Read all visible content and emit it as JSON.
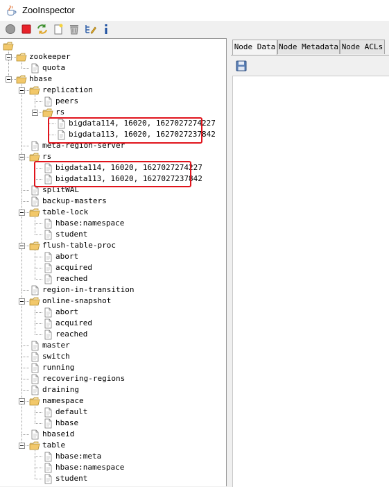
{
  "window": {
    "title": "ZooInspector"
  },
  "toolbar": {
    "buttons": [
      {
        "name": "connect-button",
        "icon": "grey-circle-icon"
      },
      {
        "name": "disconnect-button",
        "icon": "red-stop-icon"
      },
      {
        "name": "refresh-button",
        "icon": "refresh-arrows-icon"
      },
      {
        "name": "add-node-button",
        "icon": "new-document-icon"
      },
      {
        "name": "delete-node-button",
        "icon": "trash-icon"
      },
      {
        "name": "node-viewers-button",
        "icon": "tree-edit-icon"
      },
      {
        "name": "about-button",
        "icon": "info-icon"
      }
    ]
  },
  "tree": {
    "nodes": [
      {
        "label": "",
        "depth": 0,
        "type": "folder"
      },
      {
        "label": "zookeeper",
        "depth": 1,
        "type": "folder"
      },
      {
        "label": "quota",
        "depth": 2,
        "type": "file"
      },
      {
        "label": "hbase",
        "depth": 1,
        "type": "folder"
      },
      {
        "label": "replication",
        "depth": 2,
        "type": "folder"
      },
      {
        "label": "peers",
        "depth": 3,
        "type": "file"
      },
      {
        "label": "rs",
        "depth": 3,
        "type": "folder"
      },
      {
        "label": "bigdata114, 16020, 1627027274227",
        "depth": 4,
        "type": "file"
      },
      {
        "label": "bigdata113, 16020, 1627027237842",
        "depth": 4,
        "type": "file"
      },
      {
        "label": "meta-region-server",
        "depth": 2,
        "type": "file"
      },
      {
        "label": "rs",
        "depth": 2,
        "type": "folder"
      },
      {
        "label": "bigdata114, 16020, 1627027274227",
        "depth": 3,
        "type": "file"
      },
      {
        "label": "bigdata113, 16020, 1627027237842",
        "depth": 3,
        "type": "file"
      },
      {
        "label": "splitWAL",
        "depth": 2,
        "type": "file"
      },
      {
        "label": "backup-masters",
        "depth": 2,
        "type": "file"
      },
      {
        "label": "table-lock",
        "depth": 2,
        "type": "folder"
      },
      {
        "label": "hbase:namespace",
        "depth": 3,
        "type": "file"
      },
      {
        "label": "student",
        "depth": 3,
        "type": "file"
      },
      {
        "label": "flush-table-proc",
        "depth": 2,
        "type": "folder"
      },
      {
        "label": "abort",
        "depth": 3,
        "type": "file"
      },
      {
        "label": "acquired",
        "depth": 3,
        "type": "file"
      },
      {
        "label": "reached",
        "depth": 3,
        "type": "file"
      },
      {
        "label": "region-in-transition",
        "depth": 2,
        "type": "file"
      },
      {
        "label": "online-snapshot",
        "depth": 2,
        "type": "folder"
      },
      {
        "label": "abort",
        "depth": 3,
        "type": "file"
      },
      {
        "label": "acquired",
        "depth": 3,
        "type": "file"
      },
      {
        "label": "reached",
        "depth": 3,
        "type": "file"
      },
      {
        "label": "master",
        "depth": 2,
        "type": "file"
      },
      {
        "label": "switch",
        "depth": 2,
        "type": "file"
      },
      {
        "label": "running",
        "depth": 2,
        "type": "file"
      },
      {
        "label": "recovering-regions",
        "depth": 2,
        "type": "file"
      },
      {
        "label": "draining",
        "depth": 2,
        "type": "file"
      },
      {
        "label": "namespace",
        "depth": 2,
        "type": "folder"
      },
      {
        "label": "default",
        "depth": 3,
        "type": "file"
      },
      {
        "label": "hbase",
        "depth": 3,
        "type": "file"
      },
      {
        "label": "hbaseid",
        "depth": 2,
        "type": "file"
      },
      {
        "label": "table",
        "depth": 2,
        "type": "folder"
      },
      {
        "label": "hbase:meta",
        "depth": 3,
        "type": "file"
      },
      {
        "label": "hbase:namespace",
        "depth": 3,
        "type": "file"
      },
      {
        "label": "student",
        "depth": 3,
        "type": "file"
      }
    ]
  },
  "tabs": [
    {
      "label": "Node Data",
      "active": true
    },
    {
      "label": "Node Metadata",
      "active": false
    },
    {
      "label": "Node ACLs",
      "active": false
    }
  ],
  "node_data": {
    "save_icon": "floppy-disk-icon",
    "content": ""
  },
  "colors": {
    "highlight_box": "#e0141c",
    "folder": "#f2c86a"
  }
}
